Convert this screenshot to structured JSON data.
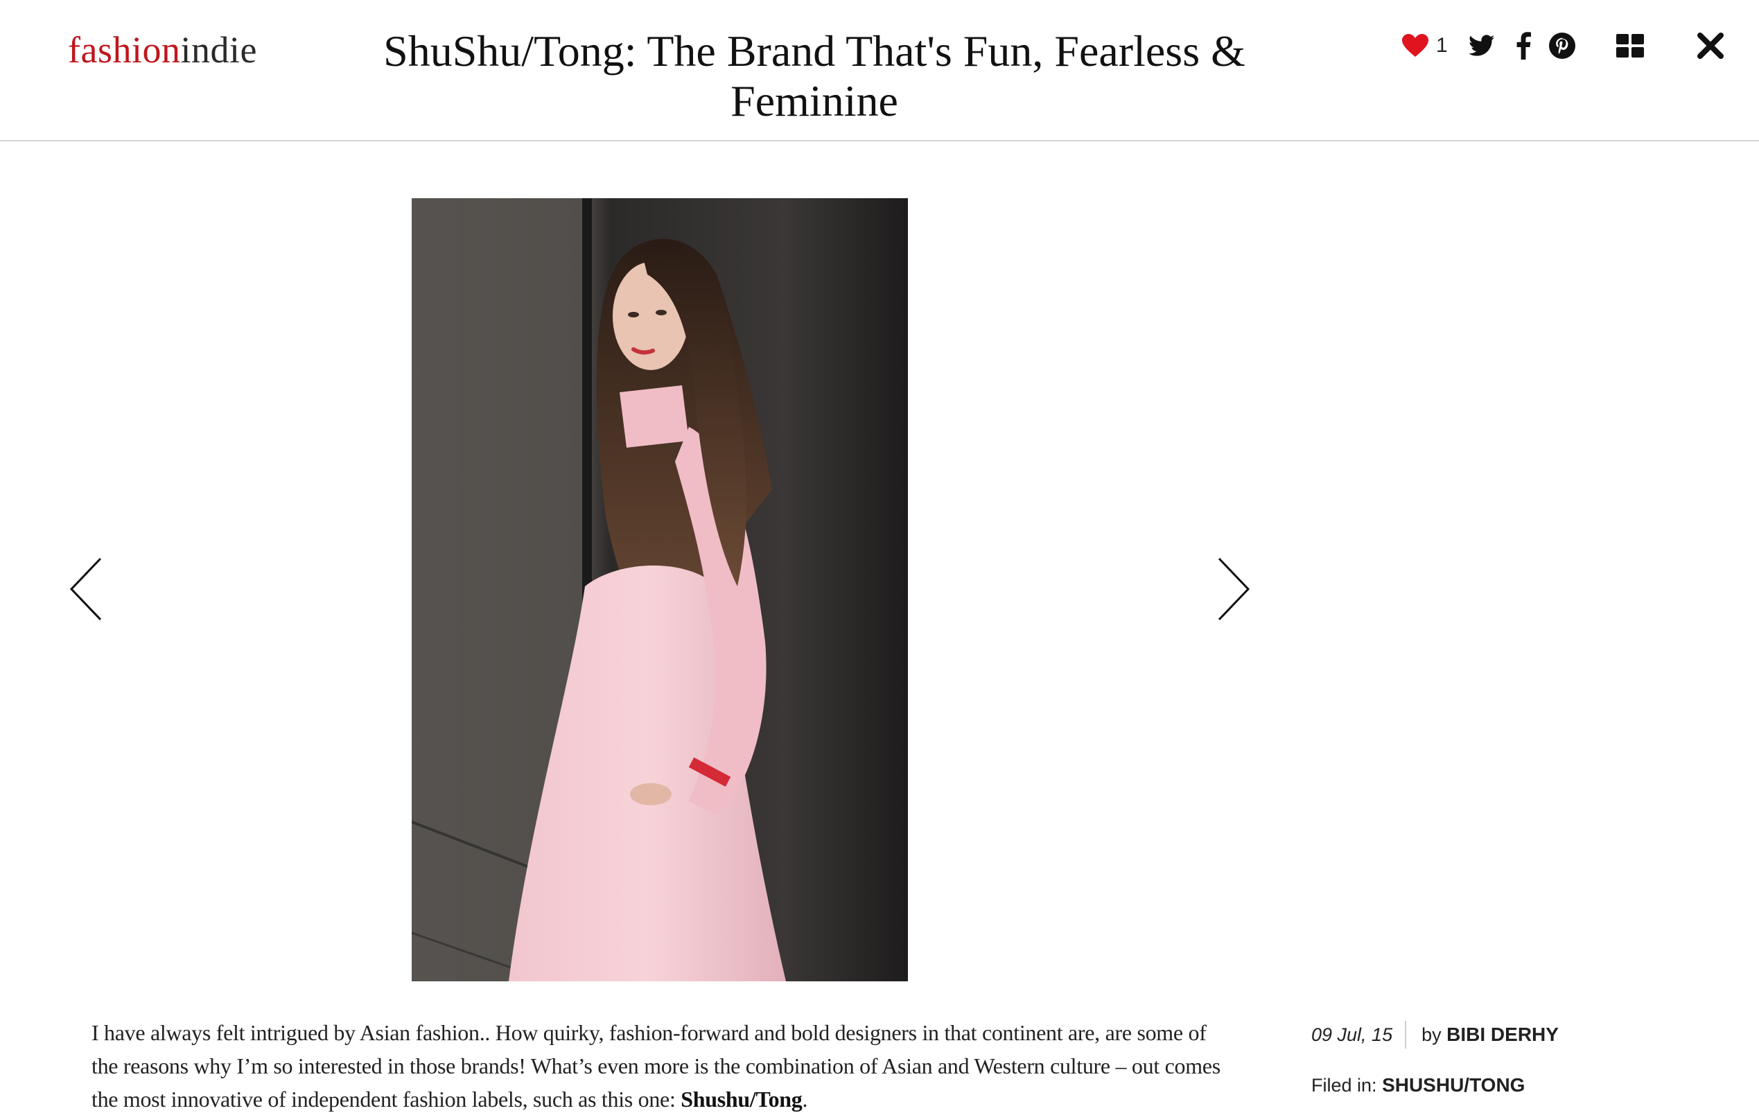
{
  "header": {
    "logo_part1": "fashion",
    "logo_part2": "indie",
    "title": "ShuShu/Tong: The Brand That's Fun, Fearless & Feminine",
    "like_count": "1",
    "icons": {
      "like": "heart-icon",
      "twitter": "twitter-icon",
      "facebook": "facebook-icon",
      "pinterest": "pinterest-icon",
      "grid": "grid-icon",
      "close": "close-icon"
    }
  },
  "slider": {
    "prev_icon": "chevron-left-icon",
    "next_icon": "chevron-right-icon",
    "image_subject": "woman-in-pink-dress"
  },
  "article": {
    "paragraph_text": "I have always felt intrigued by Asian fashion.. How quirky, fashion-forward and bold designers in that continent are, are some of the reasons why I’m so interested in those brands! What’s even more is the combination of Asian and Western culture – out comes the most innovative of independent fashion labels, such as this one: ",
    "paragraph_brand": "Shushu/Tong",
    "paragraph_end": "."
  },
  "meta": {
    "date": "09 Jul, 15",
    "by_label": "by",
    "author": "BIBI DERHY",
    "filed_label": "Filed in:",
    "filed_tag": "SHUSHU/TONG"
  },
  "colors": {
    "brand_red": "#c0161c",
    "heart_red": "#e0141e",
    "text_dark": "#1a1a1a",
    "divider": "#d4d4d4"
  }
}
